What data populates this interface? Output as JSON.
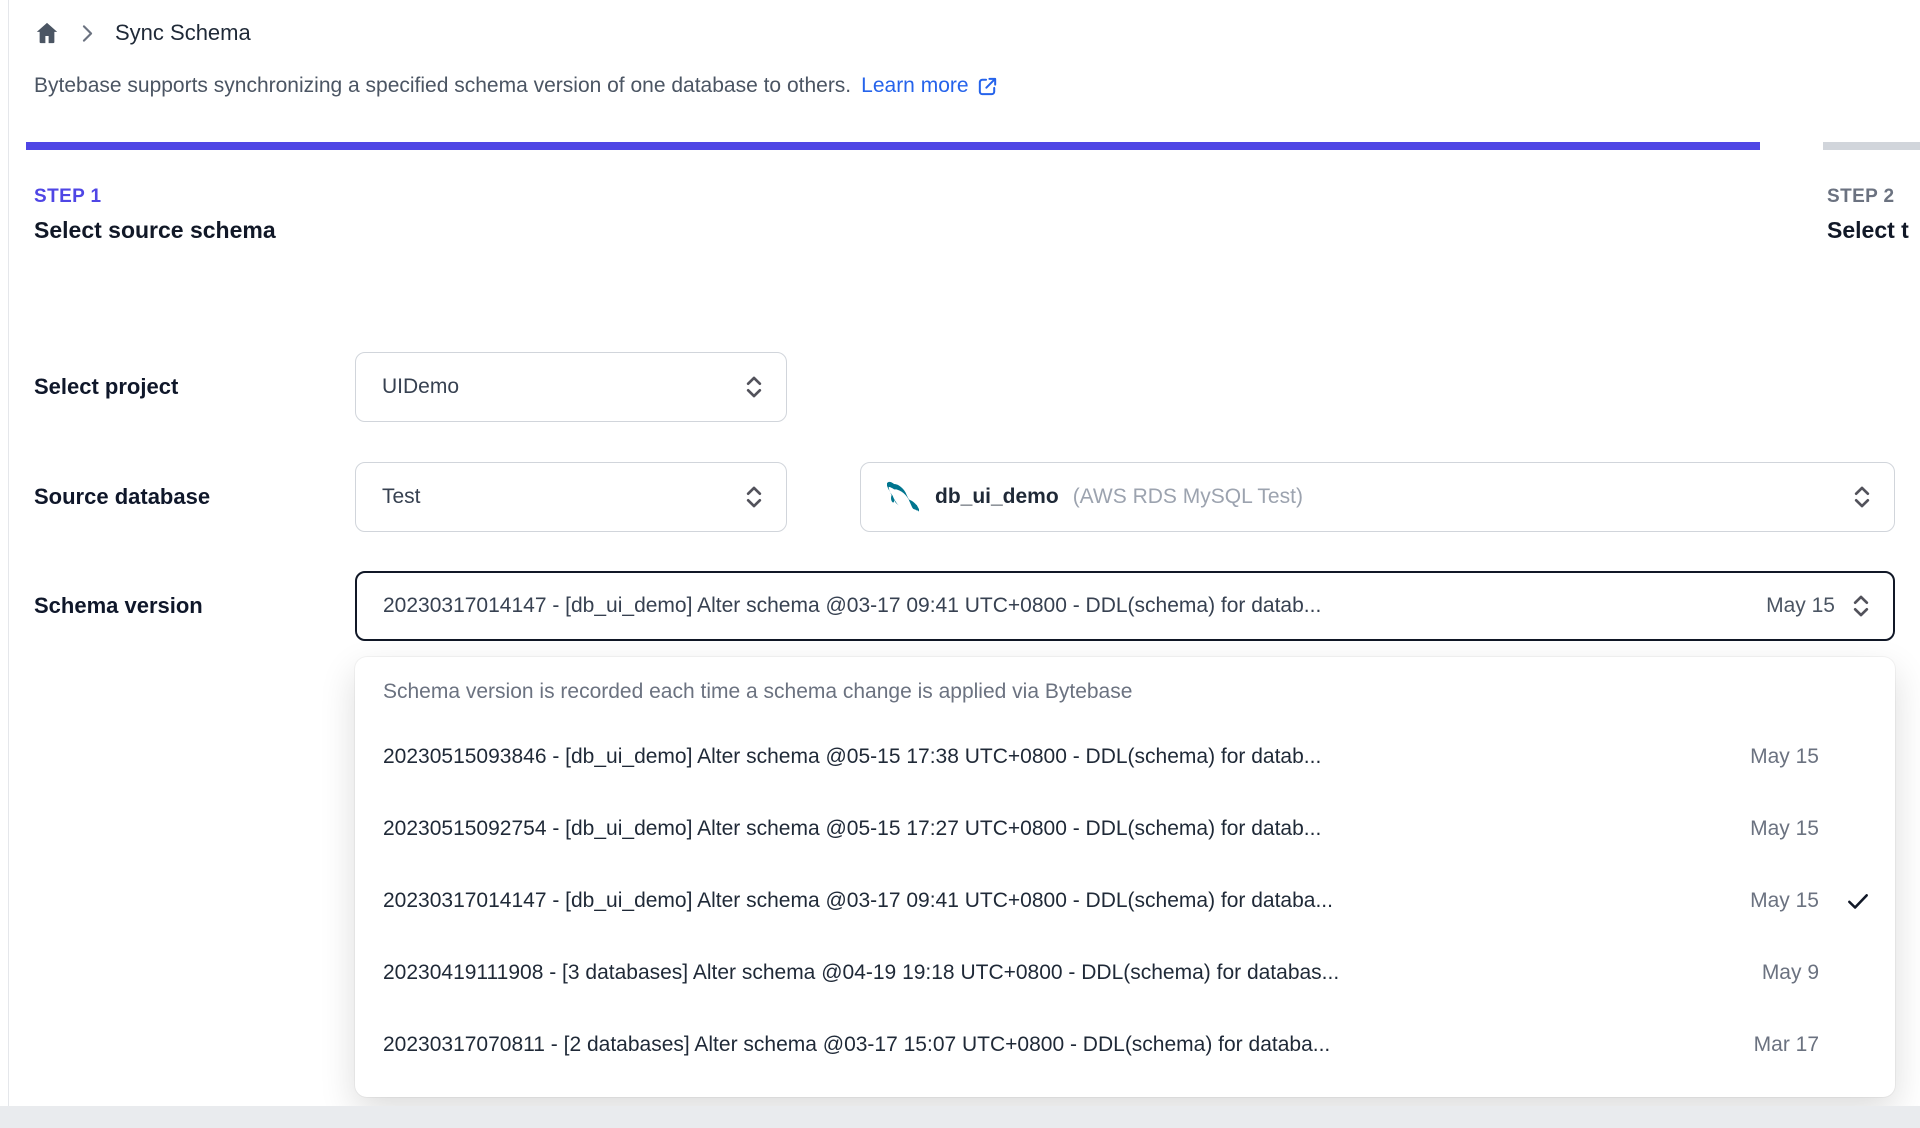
{
  "breadcrumb": {
    "title": "Sync Schema"
  },
  "intro": {
    "text": "Bytebase supports synchronizing a specified schema version of one database to others.",
    "link_label": "Learn more"
  },
  "steps": [
    {
      "label": "STEP 1",
      "title": "Select source schema",
      "active": true
    },
    {
      "label": "STEP 2",
      "title": "Select t",
      "active": false
    }
  ],
  "form": {
    "project": {
      "label": "Select project",
      "value": "UIDemo"
    },
    "source_database": {
      "label": "Source database",
      "environment_value": "Test",
      "db_name": "db_ui_demo",
      "db_detail": "(AWS RDS MySQL Test)"
    },
    "schema_version": {
      "label": "Schema version",
      "value": "20230317014147 - [db_ui_demo] Alter schema @03-17 09:41 UTC+0800 - DDL(schema) for datab...",
      "date": "May 15"
    }
  },
  "dropdown": {
    "note": "Schema version is recorded each time a schema change is applied via Bytebase",
    "options": [
      {
        "text": "20230515093846 - [db_ui_demo] Alter schema @05-15 17:38 UTC+0800 - DDL(schema) for datab...",
        "date": "May 15",
        "selected": false
      },
      {
        "text": "20230515092754 - [db_ui_demo] Alter schema @05-15 17:27 UTC+0800 - DDL(schema) for datab...",
        "date": "May 15",
        "selected": false
      },
      {
        "text": "20230317014147 - [db_ui_demo] Alter schema @03-17 09:41 UTC+0800 - DDL(schema) for databa...",
        "date": "May 15",
        "selected": true
      },
      {
        "text": "20230419111908 - [3 databases] Alter schema @04-19 19:18 UTC+0800 - DDL(schema) for databas...",
        "date": "May 9",
        "selected": false
      },
      {
        "text": "20230317070811 - [2 databases] Alter schema @03-17 15:07 UTC+0800 - DDL(schema) for databa...",
        "date": "Mar 17",
        "selected": false
      }
    ]
  },
  "colors": {
    "accent_indigo": "#4f46e5",
    "link_blue": "#2563eb",
    "progress_inactive": "#d1d5db",
    "select_border": "#d1d5db",
    "focused_border": "#111827",
    "muted_text": "#6b7280",
    "mysql_teal": "#00758f"
  }
}
